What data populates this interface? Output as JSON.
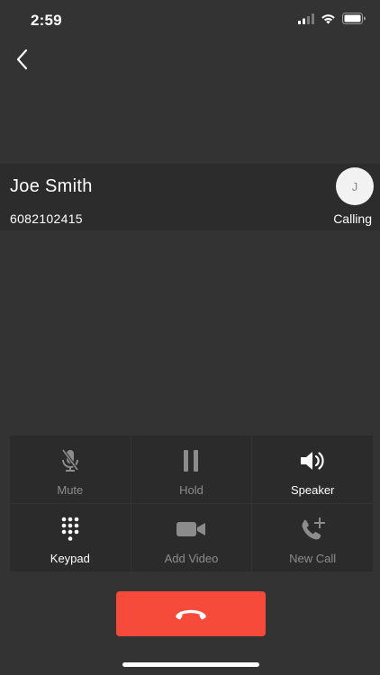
{
  "status_bar": {
    "time": "2:59"
  },
  "contact": {
    "name": "Joe Smith",
    "number": "6082102415",
    "avatar_initial": "J",
    "call_status": "Calling"
  },
  "controls": {
    "mute": "Mute",
    "hold": "Hold",
    "speaker": "Speaker",
    "keypad": "Keypad",
    "add_video": "Add Video",
    "new_call": "New Call"
  },
  "colors": {
    "background": "#333333",
    "band": "#2c2c2c",
    "end_call": "#f64a3b",
    "disabled_text": "#8c8c8c"
  },
  "icons": {
    "back": "chevron-left-icon",
    "mute": "microphone-off-icon",
    "hold": "pause-icon",
    "speaker": "speaker-icon",
    "keypad": "keypad-icon",
    "add_video": "video-camera-icon",
    "new_call": "phone-plus-icon",
    "end_call": "phone-hangup-icon"
  }
}
